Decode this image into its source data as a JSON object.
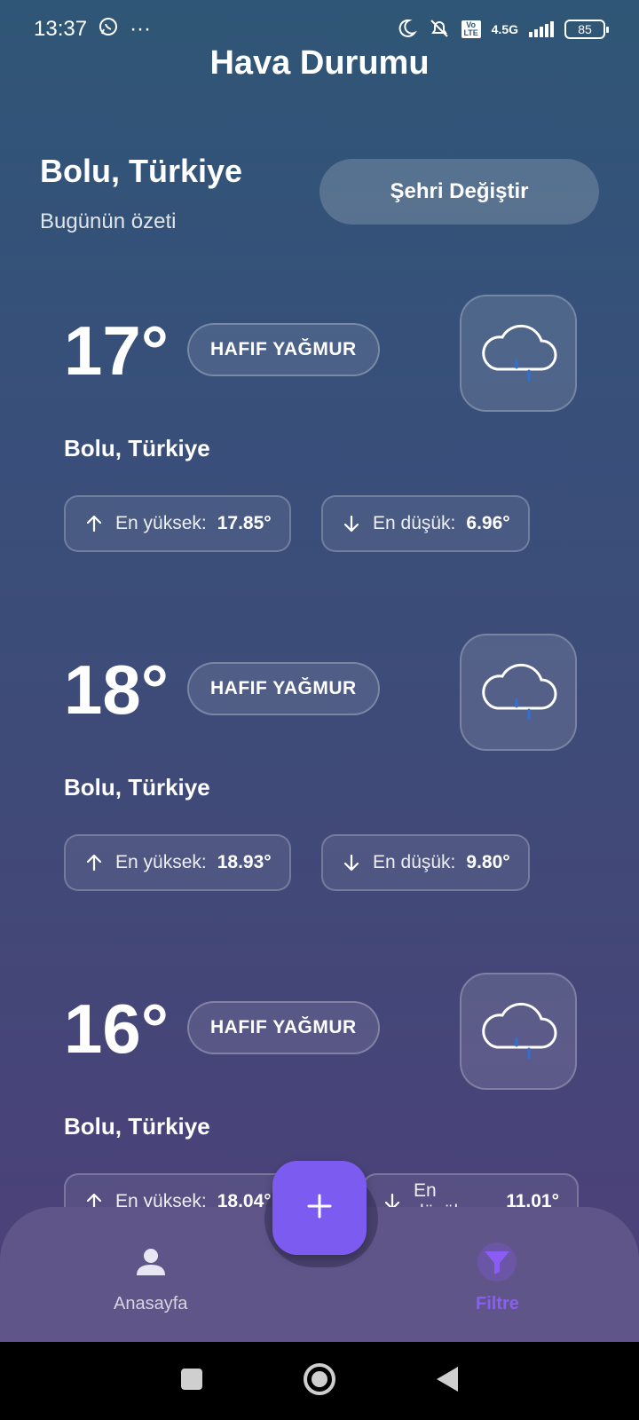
{
  "status_bar": {
    "time": "13:37",
    "more": "···",
    "network": "4.5G",
    "volte": "Vo LTE",
    "battery": "85"
  },
  "header": {
    "title": "Hava Durumu"
  },
  "location": {
    "city": "Bolu, Türkiye",
    "subtitle": "Bugünün özeti",
    "change_button": "Şehri Değiştir"
  },
  "cards": [
    {
      "temp": "17°",
      "condition": "HAFIF YAĞMUR",
      "city": "Bolu, Türkiye",
      "high_label": "En yüksek:",
      "high": "17.85°",
      "low_label": "En düşük:",
      "low": "6.96°",
      "icon": "cloud-rain-icon"
    },
    {
      "temp": "18°",
      "condition": "HAFIF YAĞMUR",
      "city": "Bolu, Türkiye",
      "high_label": "En yüksek:",
      "high": "18.93°",
      "low_label": "En düşük:",
      "low": "9.80°",
      "icon": "cloud-rain-icon"
    },
    {
      "temp": "16°",
      "condition": "HAFIF YAĞMUR",
      "city": "Bolu, Türkiye",
      "high_label": "En yüksek:",
      "high": "18.04°",
      "low_label": "En düşük:",
      "low": "11.01°",
      "icon": "cloud-rain-icon"
    }
  ],
  "bottom_nav": {
    "home": "Anasayfa",
    "filter": "Filtre",
    "active": "filter"
  },
  "colors": {
    "accent": "#7c5cf0",
    "rain": "#2f6fd6",
    "nav_bg": "#5f5589"
  }
}
